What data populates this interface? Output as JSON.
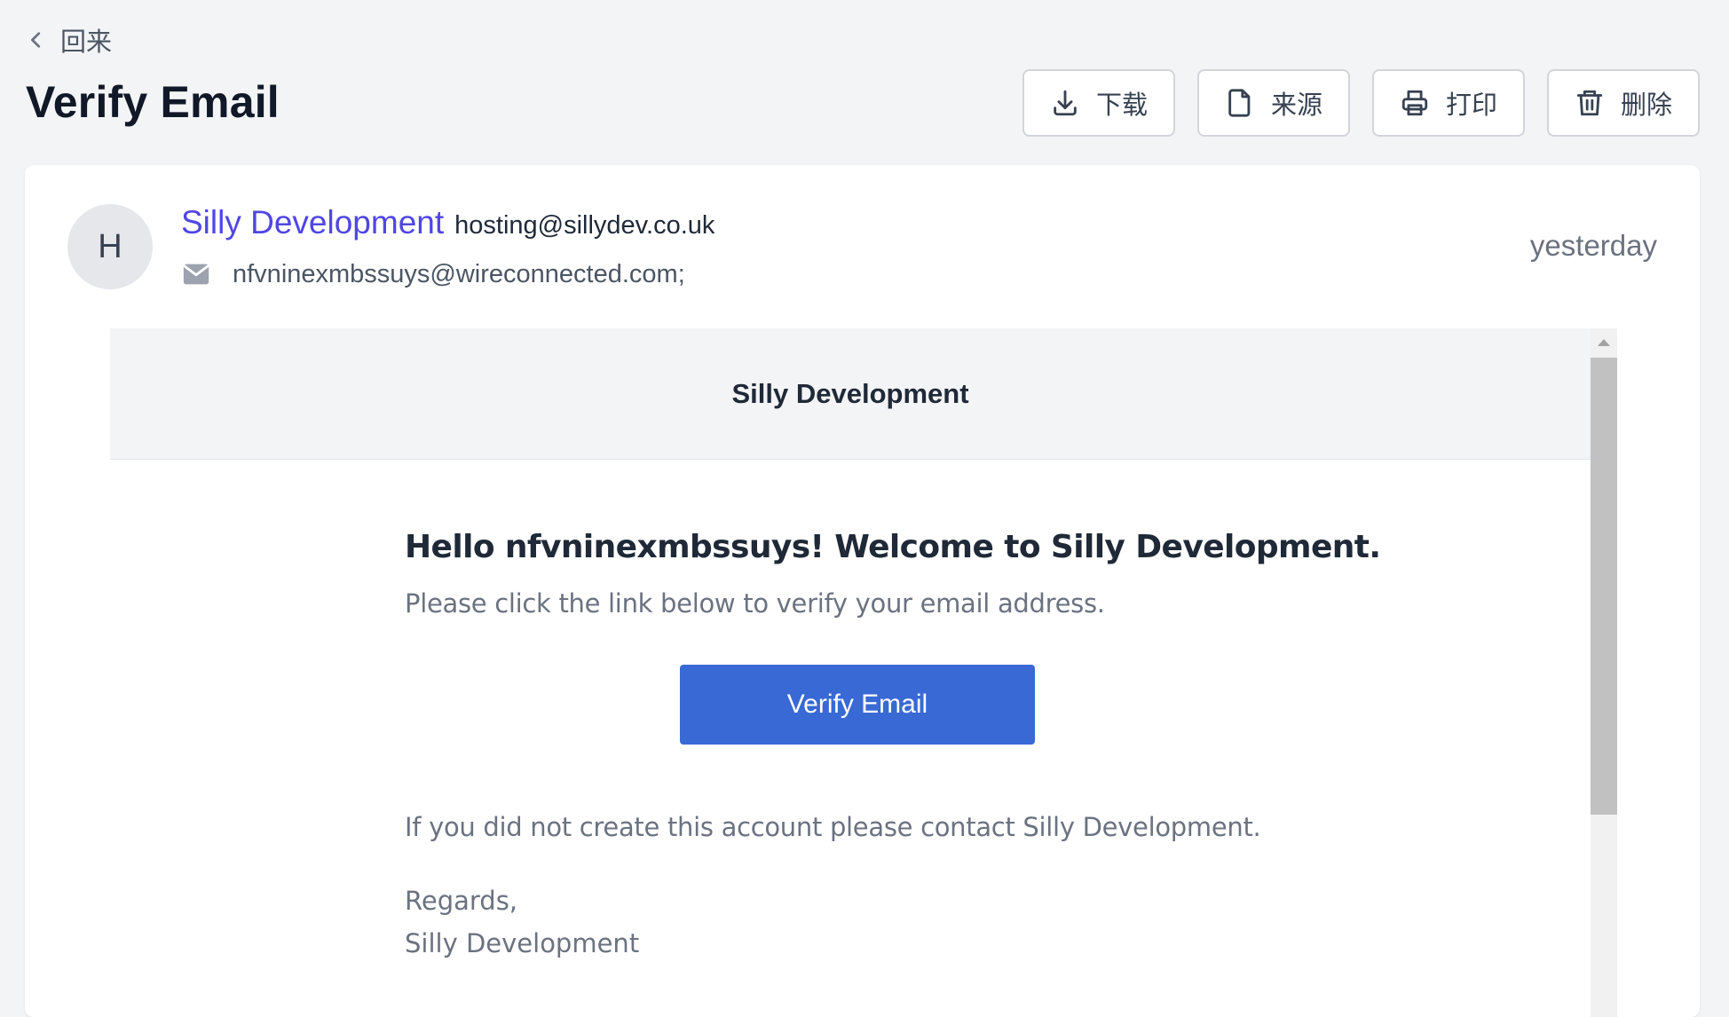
{
  "nav": {
    "back_label": "回来"
  },
  "page": {
    "title": "Verify Email"
  },
  "toolbar": {
    "download_label": "下载",
    "source_label": "来源",
    "print_label": "打印",
    "delete_label": "删除"
  },
  "message": {
    "avatar_initial": "H",
    "sender_name": "Silly Development",
    "sender_email": "hosting@sillydev.co.uk",
    "recipient": "nfvninexmbssuys@wireconnected.com;",
    "timestamp": "yesterday"
  },
  "email": {
    "header_brand": "Silly Development",
    "greeting": "Hello nfvninexmbssuys! Welcome to Silly Development.",
    "intro": "Please click the link below to verify your email address.",
    "verify_button": "Verify Email",
    "notice": "If you did not create this account please contact Silly Development.",
    "regards": "Regards,",
    "signature": "Silly Development"
  },
  "colors": {
    "accent": "#4f46e5",
    "button": "#3869d4",
    "page_background": "#f3f4f6"
  },
  "icons": {
    "back": "chevron-left-icon",
    "download": "download-icon",
    "source": "file-icon",
    "print": "printer-icon",
    "delete": "trash-icon",
    "recipient": "envelope-icon"
  }
}
